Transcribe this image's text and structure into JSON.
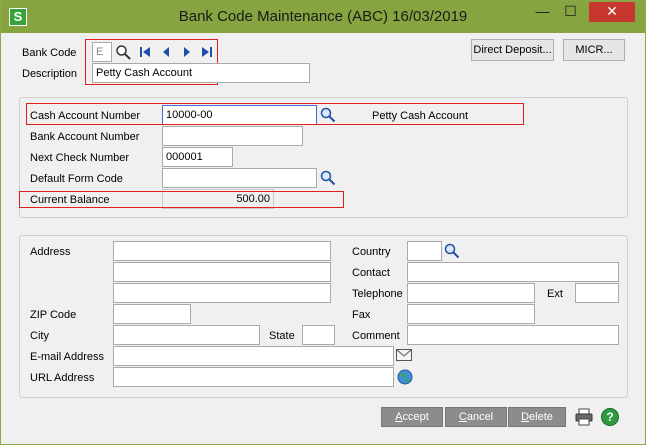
{
  "window": {
    "title": "Bank Code Maintenance (ABC) 16/03/2019",
    "app_icon_letter": "S",
    "minimize_glyph": "—",
    "maximize_glyph": "☐",
    "close_glyph": "✕"
  },
  "header": {
    "bank_code_label": "Bank Code",
    "bank_code_value": "E",
    "description_label": "Description",
    "description_value": "Petty Cash Account",
    "direct_deposit_button": "Direct Deposit...",
    "micr_button": "MICR..."
  },
  "account": {
    "cash_account_label": "Cash Account Number",
    "cash_account_value": "10000-00",
    "cash_account_desc": "Petty Cash Account",
    "bank_account_label": "Bank Account Number",
    "bank_account_value": "",
    "next_check_label": "Next Check Number",
    "next_check_value": "000001",
    "default_form_label": "Default Form Code",
    "default_form_value": "",
    "current_balance_label": "Current Balance",
    "current_balance_value": "500.00"
  },
  "address": {
    "address_label": "Address",
    "address_line1": "",
    "address_line2": "",
    "address_line3": "",
    "zip_label": "ZIP Code",
    "zip_value": "",
    "city_label": "City",
    "city_value": "",
    "state_label": "State",
    "state_value": "",
    "email_label": "E-mail Address",
    "email_value": "",
    "url_label": "URL Address",
    "url_value": "",
    "country_label": "Country",
    "country_value": "",
    "contact_label": "Contact",
    "contact_value": "",
    "telephone_label": "Telephone",
    "telephone_value": "",
    "ext_label": "Ext",
    "ext_value": "",
    "fax_label": "Fax",
    "fax_value": "",
    "comment_label": "Comment",
    "comment_value": ""
  },
  "footer": {
    "accept_first": "A",
    "accept_rest": "ccept",
    "cancel_first": "C",
    "cancel_rest": "ancel",
    "delete_first": "D",
    "delete_rest": "elete",
    "help_glyph": "?"
  },
  "colors": {
    "title_bar": "#86a43f",
    "close_button": "#c7372f",
    "highlight_box": "#e02020",
    "dark_button": "#8c8c8c"
  }
}
